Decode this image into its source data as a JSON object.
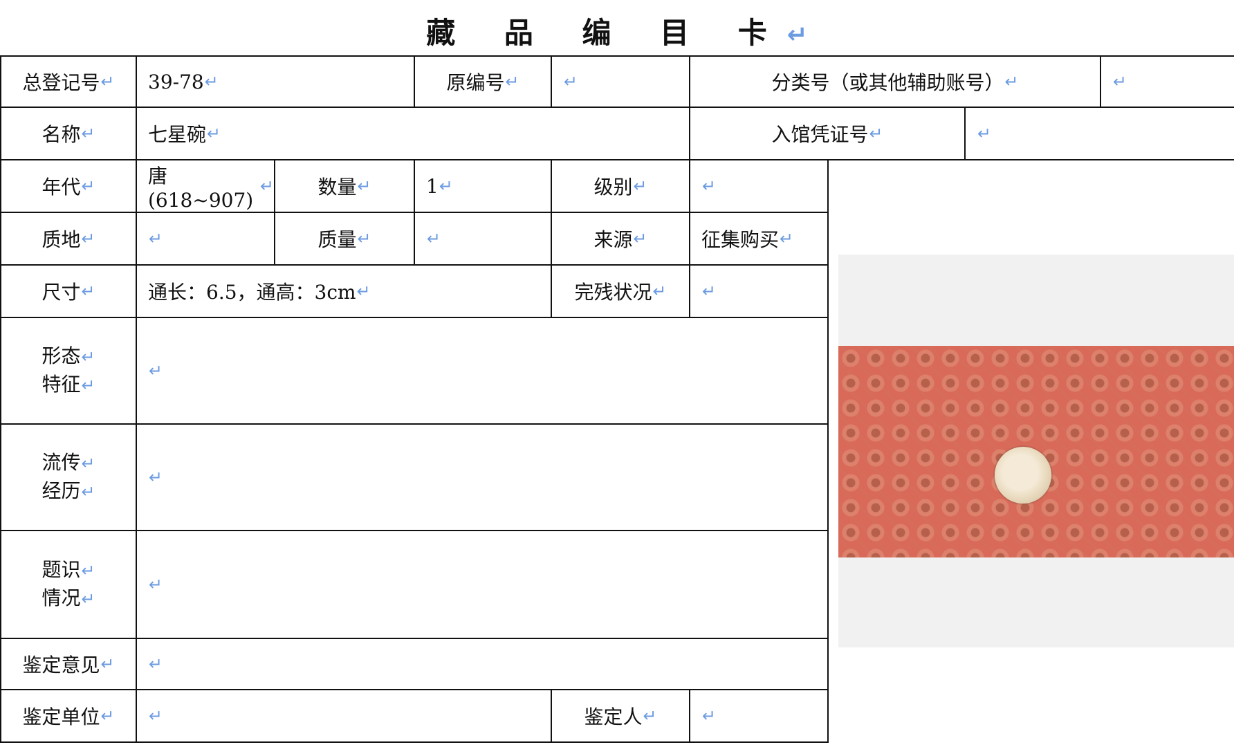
{
  "card_title": "藏 品 编 目 卡",
  "return_mark": "↵",
  "fields": {
    "registration_no_label": "总登记号",
    "registration_no_value": "39-78",
    "original_no_label": "原编号",
    "original_no_value": "",
    "classification_no_label": "分类号（或其他辅助账号）",
    "classification_no_value": "",
    "name_label": "名称",
    "name_value": "七星碗",
    "accession_voucher_label": "入馆凭证号",
    "accession_voucher_value": "",
    "period_label": "年代",
    "period_value": "唐(618~907)",
    "quantity_label": "数量",
    "quantity_value": "1",
    "grade_label": "级别",
    "grade_value": "",
    "material_label": "质地",
    "material_value": "",
    "weight_label": "质量",
    "weight_value": "",
    "source_label": "来源",
    "source_value": "征集购买",
    "dimensions_label": "尺寸",
    "dimensions_value": "通长：6.5，通高：3cm",
    "condition_label": "完残状况",
    "condition_value": "",
    "form_label_line1": "形态",
    "form_label_line2": "特征",
    "form_value": "",
    "provenance_label_line1": "流传",
    "provenance_label_line2": "经历",
    "provenance_value": "",
    "inscription_label_line1": "题识",
    "inscription_label_line2": "情况",
    "inscription_value": "",
    "appraisal_opinion_label": "鉴定意见",
    "appraisal_opinion_value": "",
    "appraisal_unit_label": "鉴定单位",
    "appraisal_unit_value": "",
    "appraiser_label": "鉴定人",
    "appraiser_value": ""
  },
  "colors": {
    "return_mark": "#6b9be0",
    "photo_background": "#d96a5a"
  }
}
